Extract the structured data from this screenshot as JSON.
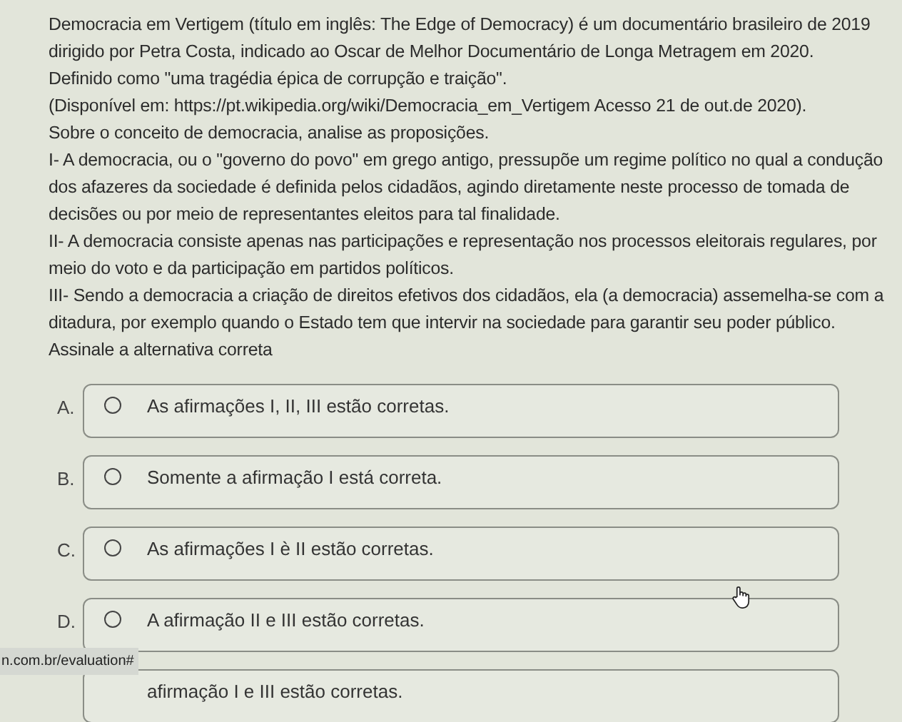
{
  "question": {
    "paragraphs": [
      "Democracia em Vertigem (título em inglês: The Edge of Democracy) é um documentário brasileiro de 2019 dirigido por Petra Costa, indicado ao Oscar de Melhor Documentário de Longa Metragem em 2020.",
      "Definido como \"uma tragédia épica de corrupção e traição\".",
      "(Disponível em: https://pt.wikipedia.org/wiki/Democracia_em_Vertigem Acesso 21 de out.de 2020).",
      "Sobre o conceito de democracia, analise as proposições.",
      "I- A democracia, ou o \"governo do povo\" em grego antigo, pressupõe um regime político no qual a condução dos afazeres da sociedade é definida pelos cidadãos, agindo diretamente neste processo de tomada de decisões ou por meio de representantes eleitos para tal finalidade.",
      "II- A democracia consiste apenas nas participações e representação nos processos eleitorais regulares, por meio do voto e da participação em partidos políticos.",
      "III- Sendo a democracia a criação de direitos efetivos dos cidadãos, ela (a democracia) assemelha-se com a ditadura, por exemplo quando o Estado tem que intervir na sociedade para garantir seu poder público.",
      "Assinale a alternativa correta"
    ]
  },
  "options": [
    {
      "letter": "A.",
      "text": "As afirmações I, II, III estão corretas.",
      "selected": false
    },
    {
      "letter": "B.",
      "text": "Somente a afirmação I está correta.",
      "selected": false
    },
    {
      "letter": "C.",
      "text": "As afirmações I è II estão corretas.",
      "selected": false
    },
    {
      "letter": "D.",
      "text": "A afirmação II e III estão corretas.",
      "selected": false
    },
    {
      "text": "afirmação I e III estão corretas."
    }
  ],
  "status_url": "n.com.br/evaluation#"
}
